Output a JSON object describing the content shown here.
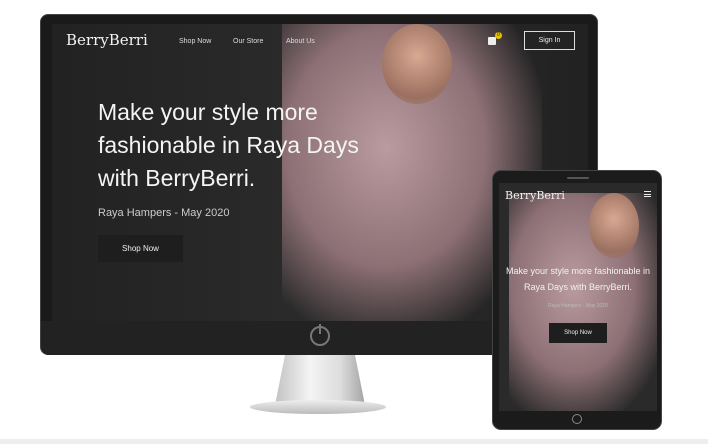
{
  "desktop": {
    "logo": "BerryBerri",
    "nav": [
      "Shop Now",
      "Our Store",
      "About Us"
    ],
    "cart_count": "0",
    "sign_in": "Sign In",
    "headline": "Make your style more fashionable in Raya Days with BerryBerri.",
    "subtitle": "Raya Hampers - May 2020",
    "cta": "Shop Now"
  },
  "tablet": {
    "logo": "BerryBerri",
    "headline": "Make your style more fashionable in Raya Days with BerryBerri.",
    "subtitle": "Raya Hampers - May 2020",
    "cta": "Shop Now"
  },
  "colors": {
    "background": "#2a2a2a",
    "badge": "#e6c200",
    "scarf": "#b99ba0"
  }
}
